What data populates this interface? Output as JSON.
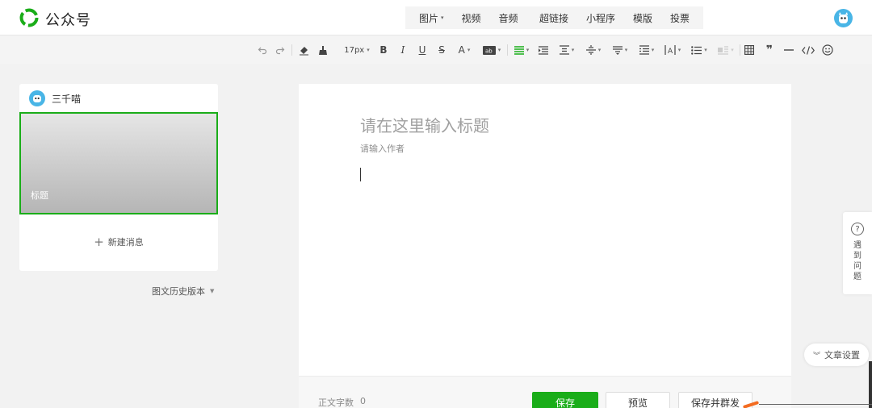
{
  "app": {
    "name": "公众号",
    "brand_color": "#1aad19",
    "logo_icon": "wechat-mp-logo-icon"
  },
  "header": {
    "insert_group_1": [
      {
        "label": "图片",
        "has_dropdown": true
      },
      {
        "label": "视频",
        "has_dropdown": false
      },
      {
        "label": "音频",
        "has_dropdown": false
      }
    ],
    "insert_group_2": [
      {
        "label": "超链接"
      },
      {
        "label": "小程序"
      },
      {
        "label": "模版"
      },
      {
        "label": "投票"
      }
    ],
    "user_avatar_icon": "user-avatar-icon"
  },
  "toolbar": {
    "font_size": "17px",
    "tools": [
      "undo-icon",
      "redo-icon",
      "format-clear-icon",
      "format-painter-icon",
      "font-size-select",
      "bold-icon",
      "italic-icon",
      "underline-icon",
      "strikethrough-icon",
      "font-color-icon",
      "background-color-icon",
      "align-icon",
      "indent-icon",
      "paragraph-spacing-icon",
      "line-spacing-icon",
      "line-height-icon",
      "letter-spacing-icon",
      "text-direction-icon",
      "list-icon",
      "image-float-icon",
      "table-icon",
      "quote-icon",
      "divider-icon",
      "code-icon",
      "emoji-icon"
    ],
    "active_color": "#1aad19"
  },
  "sidebar": {
    "account_name": "三千喵",
    "article_title": "标题",
    "new_message_label": "新建消息",
    "history_label": "图文历史版本"
  },
  "editor": {
    "title_placeholder": "请在这里输入标题",
    "author_placeholder": "请输入作者",
    "word_count_label": "正文字数",
    "word_count": "0",
    "save_label": "保存",
    "preview_label": "预览",
    "publish_label": "保存并群发"
  },
  "floating": {
    "help_label": "遇到问题",
    "settings_label": "文章设置"
  }
}
